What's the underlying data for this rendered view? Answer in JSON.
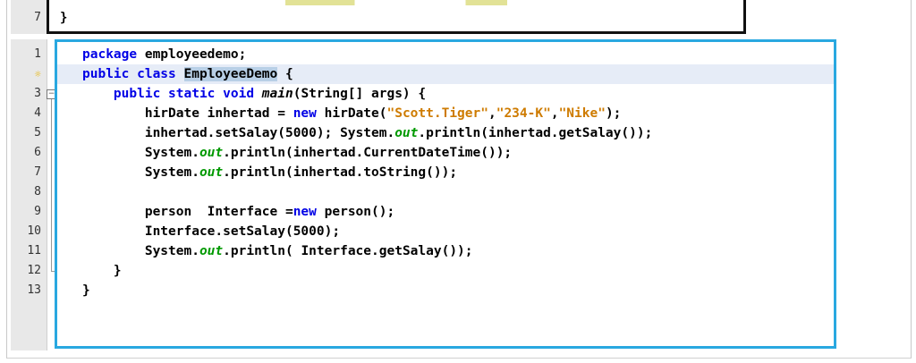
{
  "top_snippet": {
    "line_number": "7",
    "code": "}"
  },
  "editor": {
    "lines": [
      {
        "n": "1",
        "parts": [
          [
            "kw",
            "package"
          ],
          [
            "t",
            " employeedemo;"
          ]
        ]
      },
      {
        "n": "2",
        "bulb": true,
        "highlight": true,
        "parts": [
          [
            "kw",
            "public class "
          ],
          [
            "sel",
            "EmployeeDemo"
          ],
          [
            "t",
            " {"
          ]
        ]
      },
      {
        "n": "3",
        "fold": "open",
        "parts": [
          [
            "t",
            "    "
          ],
          [
            "kw",
            "public static void "
          ],
          [
            "mth",
            "main"
          ],
          [
            "t",
            "(String[] args) {"
          ]
        ]
      },
      {
        "n": "4",
        "parts": [
          [
            "t",
            "        hirDate inhertad = "
          ],
          [
            "kw",
            "new"
          ],
          [
            "t",
            " hirDate("
          ],
          [
            "str",
            "\"Scott.Tiger\""
          ],
          [
            "t",
            ","
          ],
          [
            "str",
            "\"234-K\""
          ],
          [
            "t",
            ","
          ],
          [
            "str",
            "\"Nike\""
          ],
          [
            "t",
            ");"
          ]
        ]
      },
      {
        "n": "5",
        "parts": [
          [
            "t",
            "        inhertad.setSalay(5000); System."
          ],
          [
            "fld",
            "out"
          ],
          [
            "t",
            ".println(inhertad.getSalay());"
          ]
        ]
      },
      {
        "n": "6",
        "parts": [
          [
            "t",
            "        System."
          ],
          [
            "fld",
            "out"
          ],
          [
            "t",
            ".println(inhertad.CurrentDateTime());"
          ]
        ]
      },
      {
        "n": "7",
        "parts": [
          [
            "t",
            "        System."
          ],
          [
            "fld",
            "out"
          ],
          [
            "t",
            ".println(inhertad.toString());"
          ]
        ]
      },
      {
        "n": "8",
        "parts": []
      },
      {
        "n": "9",
        "parts": [
          [
            "t",
            "        person  Interface ="
          ],
          [
            "kw",
            "new"
          ],
          [
            "t",
            " person();"
          ]
        ]
      },
      {
        "n": "10",
        "parts": [
          [
            "t",
            "        Interface.setSalay(5000);"
          ]
        ]
      },
      {
        "n": "11",
        "parts": [
          [
            "t",
            "        System."
          ],
          [
            "fld",
            "out"
          ],
          [
            "t",
            ".println( Interface.getSalay());"
          ]
        ]
      },
      {
        "n": "12",
        "fold": "end",
        "parts": [
          [
            "t",
            "    }"
          ]
        ]
      },
      {
        "n": "13",
        "parts": [
          [
            "t",
            "}"
          ]
        ]
      }
    ]
  },
  "colors": {
    "keyword": "#0000e6",
    "string": "#ce7b00",
    "static_field": "#009900",
    "editor_border": "#29a8e0",
    "selection": "#b8cfe6",
    "bulb": "#e7b400"
  }
}
